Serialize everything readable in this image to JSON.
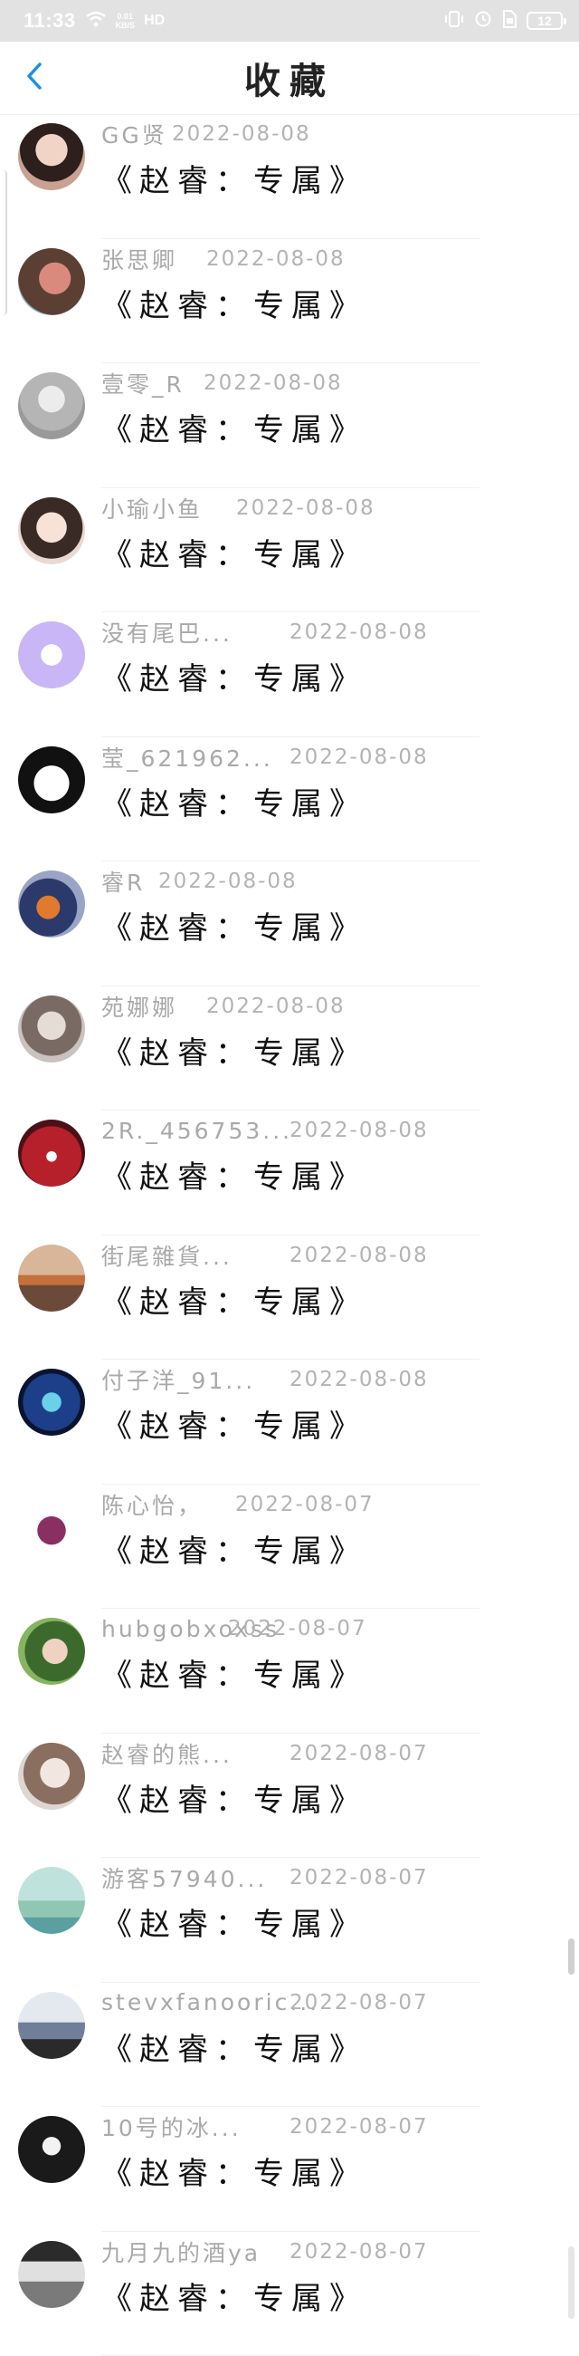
{
  "status_bar": {
    "time": "11:33",
    "net_speed_value": "0.01",
    "net_speed_unit": "KB/S",
    "network": "HD",
    "battery": "12"
  },
  "header": {
    "title": "收藏",
    "back_icon": "chevron-left-icon"
  },
  "items": [
    {
      "name": "GG贤",
      "date": "2022-08-08",
      "title": "《赵睿：专属》"
    },
    {
      "name": "张思卿",
      "date": "2022-08-08",
      "title": "《赵睿：专属》"
    },
    {
      "name": "壹零_R",
      "date": "2022-08-08",
      "title": "《赵睿：专属》"
    },
    {
      "name": "小瑜小鱼",
      "date": "2022-08-08",
      "title": "《赵睿：专属》"
    },
    {
      "name": "没有尾巴...",
      "date": "2022-08-08",
      "title": "《赵睿：专属》"
    },
    {
      "name": "莹_621962...",
      "date": "2022-08-08",
      "title": "《赵睿：专属》"
    },
    {
      "name": "睿R",
      "date": "2022-08-08",
      "title": "《赵睿：专属》"
    },
    {
      "name": "苑娜娜",
      "date": "2022-08-08",
      "title": "《赵睿：专属》"
    },
    {
      "name": "2R._456753...",
      "date": "2022-08-08",
      "title": "《赵睿：专属》"
    },
    {
      "name": "街尾雜貨...",
      "date": "2022-08-08",
      "title": "《赵睿：专属》"
    },
    {
      "name": "付子洋_91...",
      "date": "2022-08-08",
      "title": "《赵睿：专属》"
    },
    {
      "name": "陈心怡，",
      "date": "2022-08-07",
      "title": "《赵睿：专属》"
    },
    {
      "name": "hubgobxoxss",
      "date": "2022-08-07",
      "title": "《赵睿：专属》"
    },
    {
      "name": "赵睿的熊...",
      "date": "2022-08-07",
      "title": "《赵睿：专属》"
    },
    {
      "name": "游客57940...",
      "date": "2022-08-07",
      "title": "《赵睿：专属》"
    },
    {
      "name": "stevxfanooric...",
      "date": "2022-08-07",
      "title": "《赵睿：专属》"
    },
    {
      "name": "10号的冰...",
      "date": "2022-08-07",
      "title": "《赵睿：专属》"
    },
    {
      "name": "九月九的酒ya",
      "date": "2022-08-07",
      "title": "《赵睿：专属》"
    }
  ]
}
